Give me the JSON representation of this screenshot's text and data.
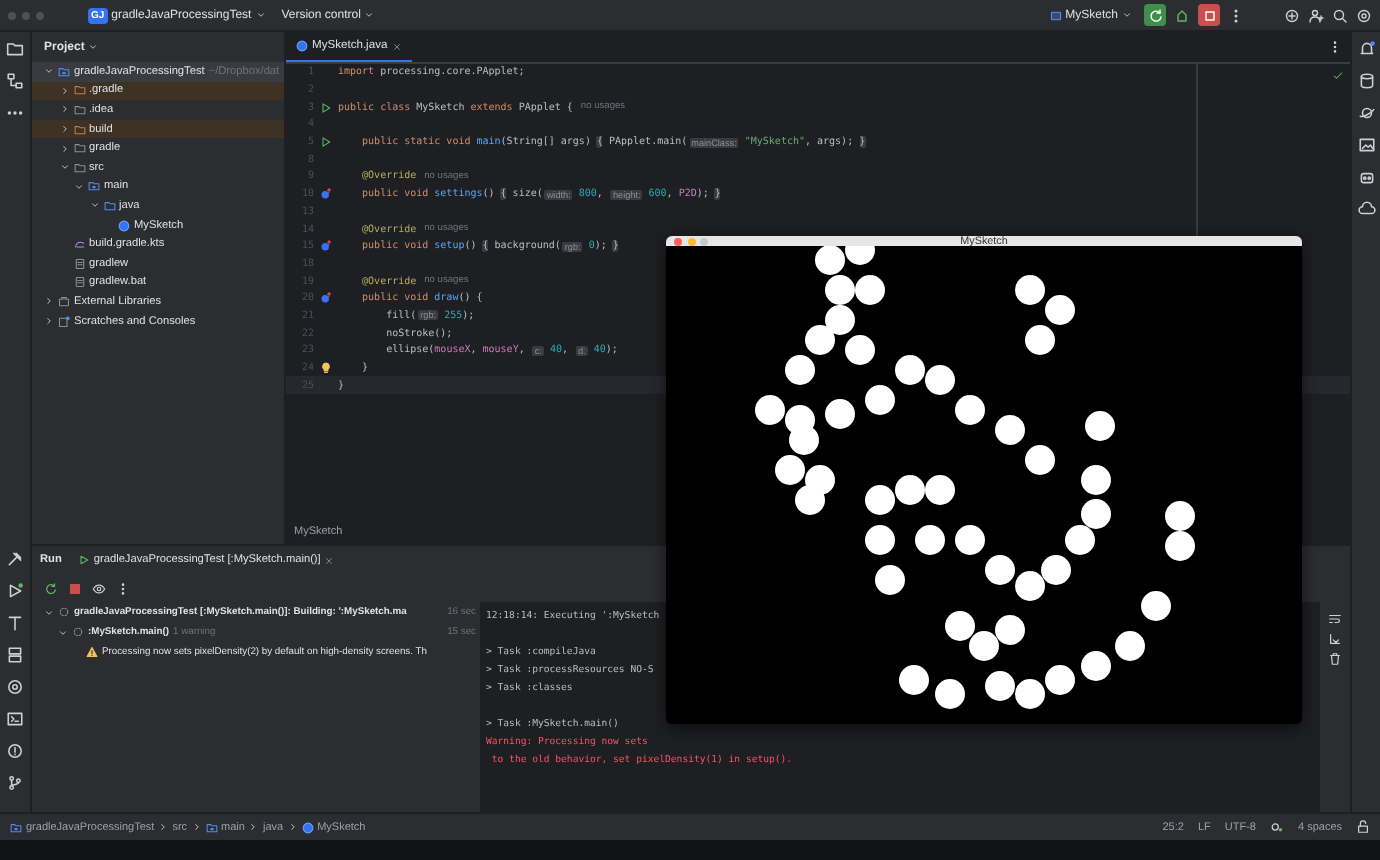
{
  "title_bar": {
    "project_badge": "GJ",
    "project": "gradleJavaProcessingTest",
    "vcs": "Version control",
    "run_config": "MySketch"
  },
  "project_panel": {
    "title": "Project",
    "tree": [
      {
        "label": "gradleJavaProcessingTest",
        "path": "~/Dropbox/dat",
        "kind": "module",
        "expanded": true,
        "selected": true,
        "children": [
          {
            "label": ".gradle",
            "kind": "excluded",
            "expanded": false,
            "selected": false
          },
          {
            "label": ".idea",
            "kind": "folder",
            "expanded": false,
            "selected": false
          },
          {
            "label": "build",
            "kind": "excluded",
            "expanded": false,
            "selected": false
          },
          {
            "label": "gradle",
            "kind": "folder",
            "expanded": false,
            "selected": false
          },
          {
            "label": "src",
            "kind": "folder",
            "expanded": true,
            "selected": false,
            "children": [
              {
                "label": "main",
                "kind": "source_module",
                "expanded": true,
                "selected": false,
                "children": [
                  {
                    "label": "java",
                    "kind": "source",
                    "expanded": true,
                    "selected": false,
                    "children": [
                      {
                        "label": "MySketch",
                        "kind": "class",
                        "selected": false
                      }
                    ]
                  }
                ]
              }
            ]
          },
          {
            "label": "build.gradle.kts",
            "kind": "gradle",
            "selected": false
          },
          {
            "label": "gradlew",
            "kind": "file",
            "selected": false
          },
          {
            "label": "gradlew.bat",
            "kind": "file",
            "selected": false
          }
        ]
      },
      {
        "label": "External Libraries",
        "kind": "library",
        "expanded": false,
        "selected": false
      },
      {
        "label": "Scratches and Consoles",
        "kind": "scratch",
        "expanded": false,
        "selected": false
      }
    ]
  },
  "editor": {
    "tab": {
      "label": "MySketch.java",
      "selected": true
    },
    "breadcrumb": "MySketch",
    "lines": [
      {
        "number": "1",
        "kind": "plain",
        "current": false,
        "tokens": [
          {
            "kind": "kw",
            "text": "import"
          },
          {
            "kind": "plain",
            "text": " processing.core.PApplet;"
          }
        ]
      },
      {
        "number": "2",
        "kind": "plain",
        "current": false
      },
      {
        "number": "3",
        "kind": "run",
        "current": false,
        "tokens": [
          {
            "kind": "kw",
            "text": "public class"
          },
          {
            "kind": "plain",
            "text": " MySketch "
          },
          {
            "kind": "kw",
            "text": "extends"
          },
          {
            "kind": "plain",
            "text": " PApplet {"
          },
          {
            "kind": "usage",
            "text": "no usages"
          }
        ]
      },
      {
        "number": "4",
        "kind": "plain",
        "current": false
      },
      {
        "number": "5",
        "kind": "run",
        "current": false,
        "tokens": [
          {
            "kind": "kw",
            "text": "    public static void"
          },
          {
            "kind": "fn",
            "text": " main"
          },
          {
            "kind": "plain",
            "text": "(String[] args) "
          },
          {
            "kind": "fold",
            "text": "{"
          },
          {
            "kind": "plain",
            "text": " PApplet.main("
          },
          {
            "kind": "hint",
            "text": "mainClass:"
          },
          {
            "kind": "string",
            "text": " \"MySketch\""
          },
          {
            "kind": "plain",
            "text": ", args); "
          },
          {
            "kind": "fold",
            "text": "}"
          }
        ]
      },
      {
        "number": "8",
        "kind": "plain",
        "current": false
      },
      {
        "number": "9",
        "kind": "plain",
        "current": false,
        "tokens": [
          {
            "kind": "annot",
            "text": "    @Override"
          },
          {
            "kind": "usage",
            "text": "no usages"
          }
        ]
      },
      {
        "number": "10",
        "kind": "override",
        "current": false,
        "tokens": [
          {
            "kind": "kw",
            "text": "    public void"
          },
          {
            "kind": "fn",
            "text": " settings"
          },
          {
            "kind": "plain",
            "text": "() "
          },
          {
            "kind": "fold",
            "text": "{"
          },
          {
            "kind": "plain",
            "text": " size("
          },
          {
            "kind": "hint",
            "text": "width:"
          },
          {
            "kind": "num",
            "text": " 800"
          },
          {
            "kind": "plain",
            "text": ", "
          },
          {
            "kind": "hint",
            "text": "height:"
          },
          {
            "kind": "num",
            "text": " 600"
          },
          {
            "kind": "plain",
            "text": ", "
          },
          {
            "kind": "field",
            "text": "P2D"
          },
          {
            "kind": "plain",
            "text": "); "
          },
          {
            "kind": "fold",
            "text": "}"
          }
        ]
      },
      {
        "number": "13",
        "kind": "plain",
        "current": false
      },
      {
        "number": "14",
        "kind": "plain",
        "current": false,
        "tokens": [
          {
            "kind": "annot",
            "text": "    @Override"
          },
          {
            "kind": "usage",
            "text": "no usages"
          }
        ]
      },
      {
        "number": "15",
        "kind": "override",
        "current": false,
        "tokens": [
          {
            "kind": "kw",
            "text": "    public void"
          },
          {
            "kind": "fn",
            "text": " setup"
          },
          {
            "kind": "plain",
            "text": "() "
          },
          {
            "kind": "fold",
            "text": "{"
          },
          {
            "kind": "plain",
            "text": " background("
          },
          {
            "kind": "hint",
            "text": "rgb:"
          },
          {
            "kind": "num",
            "text": " 0"
          },
          {
            "kind": "plain",
            "text": "); "
          },
          {
            "kind": "fold",
            "text": "}"
          }
        ]
      },
      {
        "number": "18",
        "kind": "plain",
        "current": false
      },
      {
        "number": "19",
        "kind": "plain",
        "current": false,
        "tokens": [
          {
            "kind": "annot",
            "text": "    @Override"
          },
          {
            "kind": "usage",
            "text": "no usages"
          }
        ]
      },
      {
        "number": "20",
        "kind": "override",
        "current": false,
        "tokens": [
          {
            "kind": "kw",
            "text": "    public void"
          },
          {
            "kind": "fn",
            "text": " draw"
          },
          {
            "kind": "plain",
            "text": "() {"
          }
        ]
      },
      {
        "number": "21",
        "kind": "plain",
        "current": false,
        "tokens": [
          {
            "kind": "plain",
            "text": "        fill("
          },
          {
            "kind": "hint",
            "text": "rgb:"
          },
          {
            "kind": "num",
            "text": " 255"
          },
          {
            "kind": "plain",
            "text": ");"
          }
        ]
      },
      {
        "number": "22",
        "kind": "plain",
        "current": false,
        "tokens": [
          {
            "kind": "plain",
            "text": "        noStroke();"
          }
        ]
      },
      {
        "number": "23",
        "kind": "plain",
        "current": false,
        "tokens": [
          {
            "kind": "plain",
            "text": "        ellipse("
          },
          {
            "kind": "field",
            "text": "mouseX"
          },
          {
            "kind": "plain",
            "text": ", "
          },
          {
            "kind": "field",
            "text": "mouseY"
          },
          {
            "kind": "plain",
            "text": ", "
          },
          {
            "kind": "hint",
            "text": "c:"
          },
          {
            "kind": "num",
            "text": " 40"
          },
          {
            "kind": "plain",
            "text": ", "
          },
          {
            "kind": "hint",
            "text": "d:"
          },
          {
            "kind": "num",
            "text": " 40"
          },
          {
            "kind": "plain",
            "text": ");"
          }
        ]
      },
      {
        "number": "24",
        "kind": "bulb",
        "current": false,
        "tokens": [
          {
            "kind": "plain",
            "text": "    }"
          }
        ]
      },
      {
        "number": "25",
        "kind": "plain",
        "current": true,
        "tokens": [
          {
            "kind": "plain",
            "text": "}"
          }
        ]
      }
    ]
  },
  "sketch_window": {
    "title": "MySketch"
  },
  "run_panel": {
    "title": "Run",
    "tab": "gradleJavaProcessingTest [:MySketch.main()]",
    "tree": [
      {
        "kind": "running",
        "label": "gradleJavaProcessingTest [:MySketch.main()]: Building: ':MySketch.ma",
        "time": "16 sec",
        "expanded": true,
        "children": [
          {
            "kind": "running",
            "label": ":MySketch.main()",
            "detail": "1 warning",
            "time": "15 sec",
            "expanded": true,
            "children": [
              {
                "kind": "warning",
                "label": "Processing now sets pixelDensity(2) by default on high-density screens. Th"
              }
            ]
          }
        ]
      }
    ],
    "console": [
      {
        "kind": "info",
        "text": "12:18:14: Executing ':MySketch"
      },
      {
        "kind": "blank"
      },
      {
        "kind": "info",
        "text": "> Task :compileJava"
      },
      {
        "kind": "info",
        "text": "> Task :processResources NO-S"
      },
      {
        "kind": "info",
        "text": "> Task :classes"
      },
      {
        "kind": "blank"
      },
      {
        "kind": "info",
        "text": "> Task :MySketch.main()"
      },
      {
        "kind": "error",
        "text": "Warning: Processing now sets"
      },
      {
        "kind": "error",
        "text": " to the old behavior, set pixelDensity(1) in setup()."
      }
    ]
  },
  "status_bar": {
    "breadcrumbs": [
      {
        "label": "gradleJavaProcessingTest",
        "kind": "module"
      },
      {
        "label": "src",
        "kind": "plain"
      },
      {
        "label": "main",
        "kind": "source_module"
      },
      {
        "label": "java",
        "kind": "plain"
      },
      {
        "label": "MySketch",
        "kind": "class"
      }
    ],
    "position": "25:2",
    "line_ending": "LF",
    "encoding": "UTF-8",
    "indent": "4 spaces"
  }
}
